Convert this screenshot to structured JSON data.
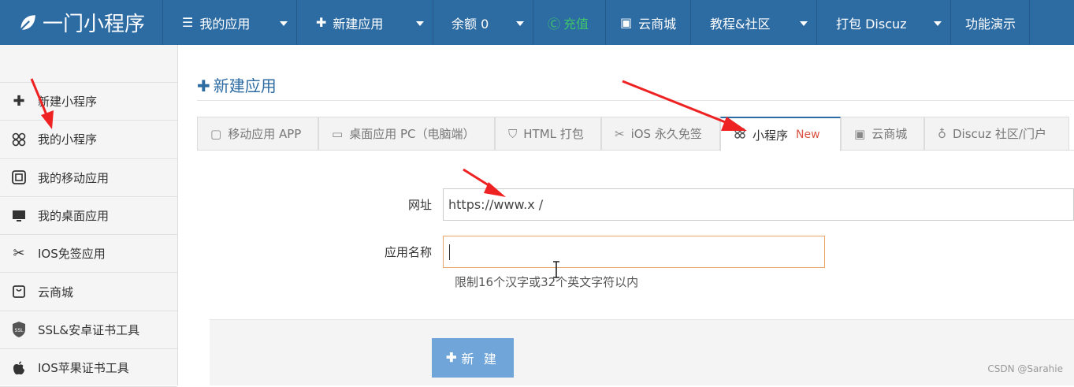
{
  "topnav": {
    "brand": "一门小程序",
    "items": [
      {
        "label": "我的应用",
        "icon": "menu-icon"
      },
      {
        "label": "新建应用",
        "icon": "plus-icon"
      },
      {
        "label": "余额 0",
        "icon": ""
      },
      {
        "label": "充值",
        "icon": "recharge-icon"
      },
      {
        "label": "云商城",
        "icon": "shop-icon"
      },
      {
        "label": "教程&社区",
        "icon": ""
      },
      {
        "label": "打包 Discuz",
        "icon": ""
      },
      {
        "label": "功能演示",
        "icon": ""
      }
    ]
  },
  "sidebar": {
    "items": [
      {
        "label": "新建小程序",
        "icon": "plus-icon"
      },
      {
        "label": "我的小程序",
        "icon": "miniprogram-icon"
      },
      {
        "label": "我的移动应用",
        "icon": "mobile-icon"
      },
      {
        "label": "我的桌面应用",
        "icon": "desktop-icon"
      },
      {
        "label": "IOS免签应用",
        "icon": "scissors-icon"
      },
      {
        "label": "云商城",
        "icon": "shop-icon"
      },
      {
        "label": "SSL&安卓证书工具",
        "icon": "ssl-icon"
      },
      {
        "label": "IOS苹果证书工具",
        "icon": "apple-icon"
      }
    ]
  },
  "main": {
    "title": "新建应用",
    "tabs": [
      {
        "label": "移动应用 APP",
        "icon": "mobile-icon"
      },
      {
        "label": "桌面应用 PC（电脑端）",
        "icon": "desktop-icon"
      },
      {
        "label": "HTML 打包",
        "icon": "html5-icon"
      },
      {
        "label": "iOS 永久免签",
        "icon": "scissors-icon"
      },
      {
        "label": "小程序",
        "icon": "miniprogram-icon",
        "badge": "New"
      },
      {
        "label": "云商城",
        "icon": "shop-icon"
      },
      {
        "label": "Discuz 社区/门户",
        "icon": "discuz-icon"
      }
    ],
    "form": {
      "url_label": "网址",
      "url_value": "https://www.x                        /",
      "name_label": "应用名称",
      "name_value": "",
      "hint": "限制16个汉字或32个英文字符以内"
    },
    "create_button": "新 建"
  },
  "watermark": "CSDN @Sarahie",
  "colors": {
    "brand": "#2d6ba3",
    "button": "#6fa5d8",
    "badge": "#d9533f",
    "arrow": "#ee2222"
  }
}
